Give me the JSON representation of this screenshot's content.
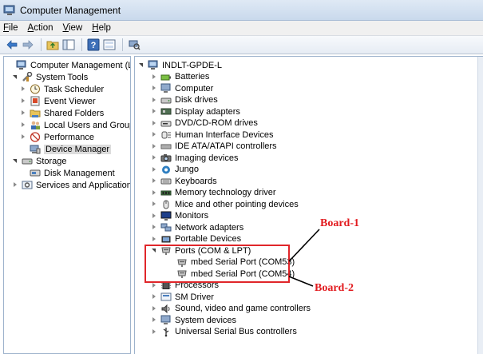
{
  "window": {
    "title": "Computer Management"
  },
  "menu": [
    {
      "label": "File",
      "accel": "F",
      "rest": "ile"
    },
    {
      "label": "Action",
      "accel": "A",
      "rest": "ction"
    },
    {
      "label": "View",
      "accel": "V",
      "rest": "iew"
    },
    {
      "label": "Help",
      "accel": "H",
      "rest": "elp"
    }
  ],
  "left_tree": [
    {
      "label": "Computer Management (Local",
      "icon": "computer-management-icon",
      "arrow": "none"
    },
    {
      "label": "System Tools",
      "icon": "system-tools-icon",
      "arrow": "expanded"
    },
    {
      "label": "Task Scheduler",
      "icon": "clock-icon",
      "arrow": "collapsed"
    },
    {
      "label": "Event Viewer",
      "icon": "event-viewer-icon",
      "arrow": "collapsed"
    },
    {
      "label": "Shared Folders",
      "icon": "shared-folder-icon",
      "arrow": "collapsed"
    },
    {
      "label": "Local Users and Groups",
      "icon": "users-icon",
      "arrow": "collapsed"
    },
    {
      "label": "Performance",
      "icon": "performance-icon",
      "arrow": "collapsed"
    },
    {
      "label": "Device Manager",
      "icon": "device-manager-icon",
      "arrow": "none",
      "selected": true
    },
    {
      "label": "Storage",
      "icon": "storage-icon",
      "arrow": "expanded"
    },
    {
      "label": "Disk Management",
      "icon": "disk-management-icon",
      "arrow": "none"
    },
    {
      "label": "Services and Applications",
      "icon": "services-icon",
      "arrow": "collapsed"
    }
  ],
  "device_tree": {
    "root": "INDLT-GPDE-L",
    "items": [
      {
        "label": "Batteries",
        "icon": "battery-icon",
        "arrow": "collapsed"
      },
      {
        "label": "Computer",
        "icon": "computer-icon",
        "arrow": "collapsed"
      },
      {
        "label": "Disk drives",
        "icon": "disk-drive-icon",
        "arrow": "collapsed"
      },
      {
        "label": "Display adapters",
        "icon": "display-adapter-icon",
        "arrow": "collapsed"
      },
      {
        "label": "DVD/CD-ROM drives",
        "icon": "dvd-icon",
        "arrow": "collapsed"
      },
      {
        "label": "Human Interface Devices",
        "icon": "hid-icon",
        "arrow": "collapsed"
      },
      {
        "label": "IDE ATA/ATAPI controllers",
        "icon": "ide-icon",
        "arrow": "collapsed"
      },
      {
        "label": "Imaging devices",
        "icon": "camera-icon",
        "arrow": "collapsed"
      },
      {
        "label": "Jungo",
        "icon": "jungo-icon",
        "arrow": "collapsed"
      },
      {
        "label": "Keyboards",
        "icon": "keyboard-icon",
        "arrow": "collapsed"
      },
      {
        "label": "Memory technology driver",
        "icon": "memory-icon",
        "arrow": "collapsed"
      },
      {
        "label": "Mice and other pointing devices",
        "icon": "mouse-icon",
        "arrow": "collapsed"
      },
      {
        "label": "Monitors",
        "icon": "monitor-icon",
        "arrow": "collapsed"
      },
      {
        "label": "Network adapters",
        "icon": "network-icon",
        "arrow": "collapsed"
      },
      {
        "label": "Portable Devices",
        "icon": "portable-device-icon",
        "arrow": "collapsed"
      },
      {
        "label": "Ports (COM & LPT)",
        "icon": "port-icon",
        "arrow": "expanded"
      },
      {
        "label": "mbed Serial Port (COM53)",
        "icon": "port-icon",
        "arrow": "none",
        "child": true
      },
      {
        "label": "mbed Serial Port (COM54)",
        "icon": "port-icon",
        "arrow": "none",
        "child": true
      },
      {
        "label": "Processors",
        "icon": "processor-icon",
        "arrow": "collapsed"
      },
      {
        "label": "SM Driver",
        "icon": "sm-driver-icon",
        "arrow": "collapsed"
      },
      {
        "label": "Sound, video and game controllers",
        "icon": "sound-icon",
        "arrow": "collapsed"
      },
      {
        "label": "System devices",
        "icon": "system-device-icon",
        "arrow": "collapsed"
      },
      {
        "label": "Universal Serial Bus controllers",
        "icon": "usb-icon",
        "arrow": "collapsed"
      }
    ]
  },
  "annotations": {
    "board1": "Board-1",
    "board2": "Board-2",
    "highlight_color": "#e0262a"
  }
}
